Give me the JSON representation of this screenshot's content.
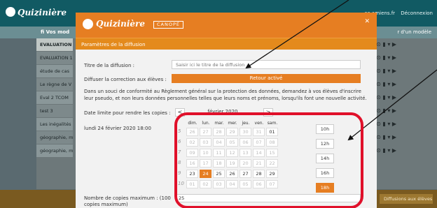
{
  "app": {
    "logo": "Quizinière",
    "user_links": [
      "ac-amiens.fr",
      "Déconnexion"
    ]
  },
  "bg_header": {
    "left_label": "fi  Vos mod",
    "right_label": "r d'un modèle"
  },
  "bg_list": {
    "rows": [
      "EVALUATION 1",
      "EVALUATION 1",
      "étude de cas",
      "Le règne de V",
      "Eval 2 TCOM",
      "test 3",
      "Les inégalités",
      "géographie, mo",
      "géographie, mo"
    ],
    "action_icons": "◻ ⊙ ▮ ▾ ▶"
  },
  "bg_footer": {
    "button_label": "Diffusions aux élèves"
  },
  "modal": {
    "logo": "Quizinière",
    "logo_badge": "CANOPÉ",
    "close_icon": "✕",
    "subtitle": "Paramètres de la diffusion",
    "title_label": "Titre de la diffusion :",
    "title_placeholder": "Saisir ici le titre de la diffusion",
    "correction_label": "Diffuser la correction aux élèves :",
    "correction_button": "Retour activé",
    "notice": "Dans un souci de conformité au Règlement général sur la protection des données, demandez à vos élèves d'inscrire leur pseudo, et non leurs données personnelles telles que leurs noms et prénoms, lorsqu'ils font une nouvelle activité.",
    "date_label": "Date limite pour rendre les copies :",
    "selected_date": "lundi 24 février 2020 18:00",
    "month_label": "février 2020",
    "prev_label": "<",
    "next_label": ">",
    "copies_label": "Nombre de copies maximum : (100 copies maximum)",
    "copies_value": "25"
  },
  "calendar": {
    "day_headers": [
      "dim.",
      "lun.",
      "mar.",
      "mer.",
      "jeu.",
      "ven.",
      "sam."
    ],
    "weeks": [
      {
        "num": "5",
        "days": [
          "26",
          "27",
          "28",
          "29",
          "30",
          "31",
          "01"
        ]
      },
      {
        "num": "6",
        "days": [
          "02",
          "03",
          "04",
          "05",
          "06",
          "07",
          "08"
        ]
      },
      {
        "num": "7",
        "days": [
          "09",
          "10",
          "11",
          "12",
          "13",
          "14",
          "15"
        ]
      },
      {
        "num": "8",
        "days": [
          "16",
          "17",
          "18",
          "19",
          "20",
          "21",
          "22"
        ]
      },
      {
        "num": "9",
        "days": [
          "23",
          "24",
          "25",
          "26",
          "27",
          "28",
          "29"
        ]
      },
      {
        "num": "10",
        "days": [
          "01",
          "02",
          "03",
          "04",
          "05",
          "06",
          "07"
        ]
      }
    ],
    "selected_day": "24",
    "time_slots": [
      "10h",
      "12h",
      "14h",
      "16h",
      "18h"
    ],
    "selected_time": "18h"
  },
  "colors": {
    "accent": "#e67e22",
    "annotation_red": "#e0102a",
    "bg_topbar": "#115a63"
  }
}
